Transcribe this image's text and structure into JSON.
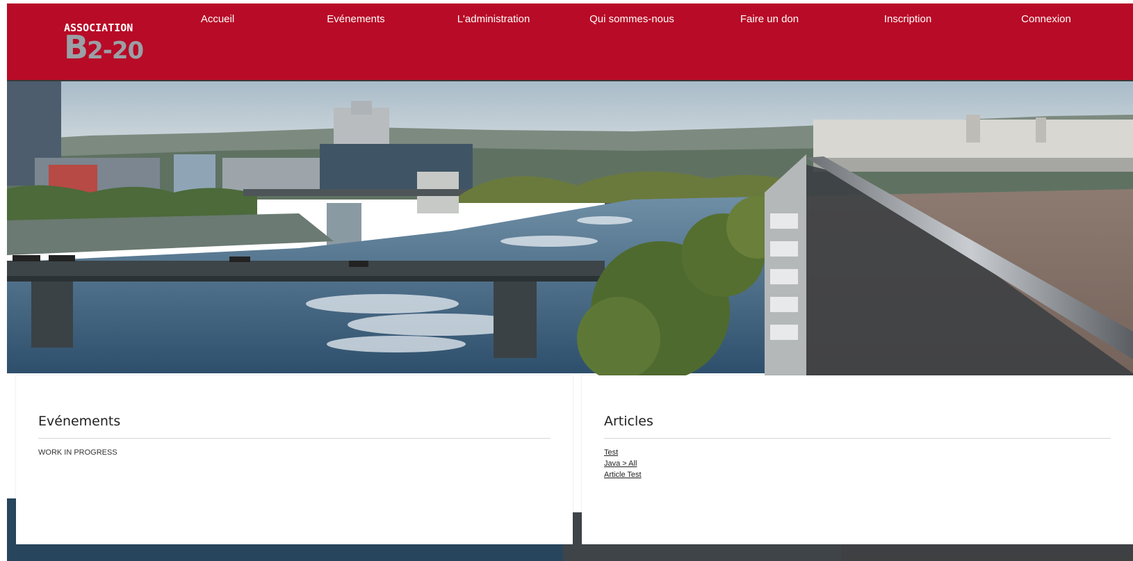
{
  "colors": {
    "header_bg": "#b80b27",
    "nav_text": "#ffffff",
    "logo_gray": "#9aa0a6"
  },
  "logo": {
    "top_text": "ASSOCIATION",
    "b_letter": "B",
    "number": "2-20"
  },
  "nav": {
    "items": [
      {
        "label": "Accueil"
      },
      {
        "label": "Evénements"
      },
      {
        "label": "L'administration"
      },
      {
        "label": "Qui sommes-nous"
      },
      {
        "label": "Faire un don"
      },
      {
        "label": "Inscription"
      },
      {
        "label": "Connexion"
      }
    ]
  },
  "events_card": {
    "title": "Evénements",
    "text": "WORK IN PROGRESS"
  },
  "articles_card": {
    "title": "Articles",
    "links": [
      {
        "label": "Test"
      },
      {
        "label": "Java > All"
      },
      {
        "label": "Article Test"
      }
    ]
  }
}
